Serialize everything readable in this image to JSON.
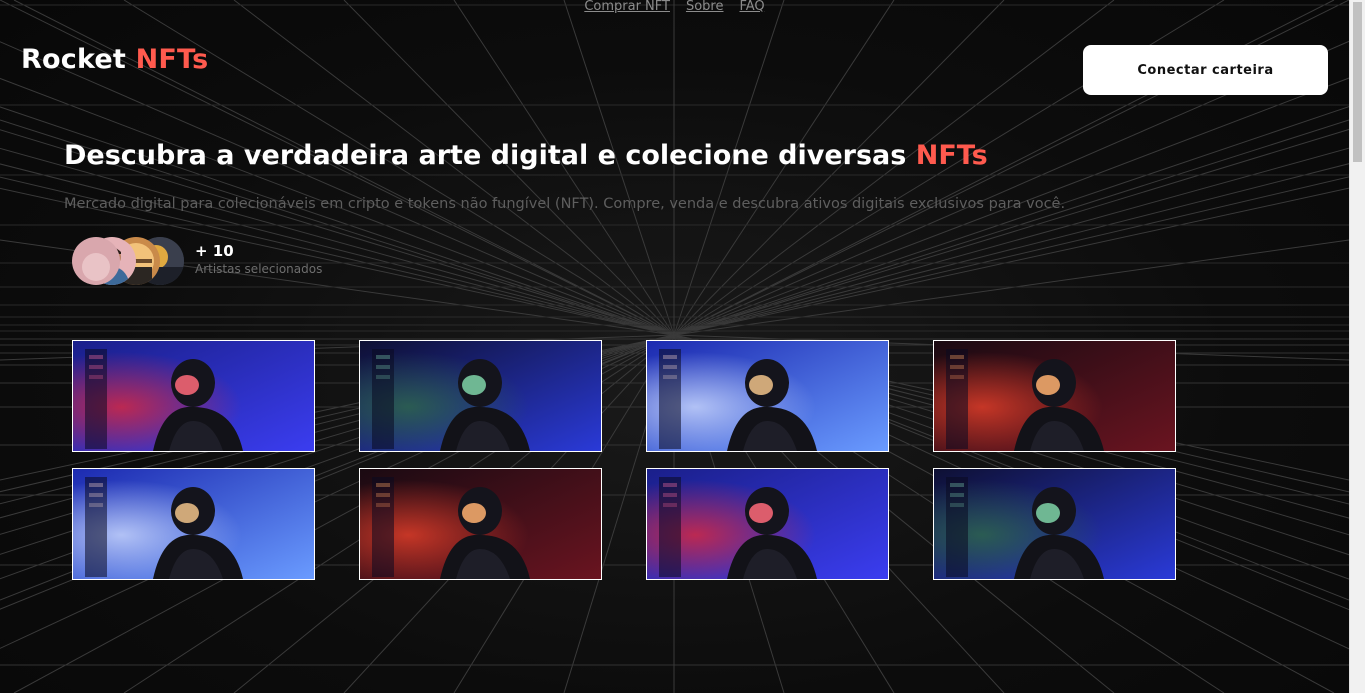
{
  "nav": {
    "links": [
      "Comprar NFT",
      "Sobre",
      "FAQ"
    ]
  },
  "logo": {
    "primary": "Rocket",
    "accent": "NFTs"
  },
  "header": {
    "connect_label": "Conectar carteira"
  },
  "hero": {
    "title_main": "Descubra a verdadeira arte digital e colecione diversas",
    "title_accent": "NFTs",
    "subtitle": "Mercado digital para colecionáveis em cripto e tokens não fungível (NFT). Compre, venda e descubra ativos digitais exclusivos para você."
  },
  "artists": {
    "count": "+ 10",
    "label": "Artistas selecionados"
  },
  "gallery": {
    "items": [
      {
        "name": "nft-astronaut-blue-red",
        "scene": "blue-red"
      },
      {
        "name": "nft-astronaut-green-blue",
        "scene": "green-blue"
      },
      {
        "name": "nft-astronaut-blue-light",
        "scene": "blue-light"
      },
      {
        "name": "nft-astronaut-red-dark",
        "scene": "red-dark"
      },
      {
        "name": "nft-astronaut-blue-light-2",
        "scene": "blue-light"
      },
      {
        "name": "nft-astronaut-red-dark-2",
        "scene": "red-dark"
      },
      {
        "name": "nft-astronaut-blue-red-2",
        "scene": "blue-red"
      },
      {
        "name": "nft-astronaut-green-blue-2",
        "scene": "green-blue"
      }
    ]
  },
  "colors": {
    "accent": "#ff5a4e",
    "background": "#0b0b0b",
    "button_bg": "#ffffff"
  }
}
